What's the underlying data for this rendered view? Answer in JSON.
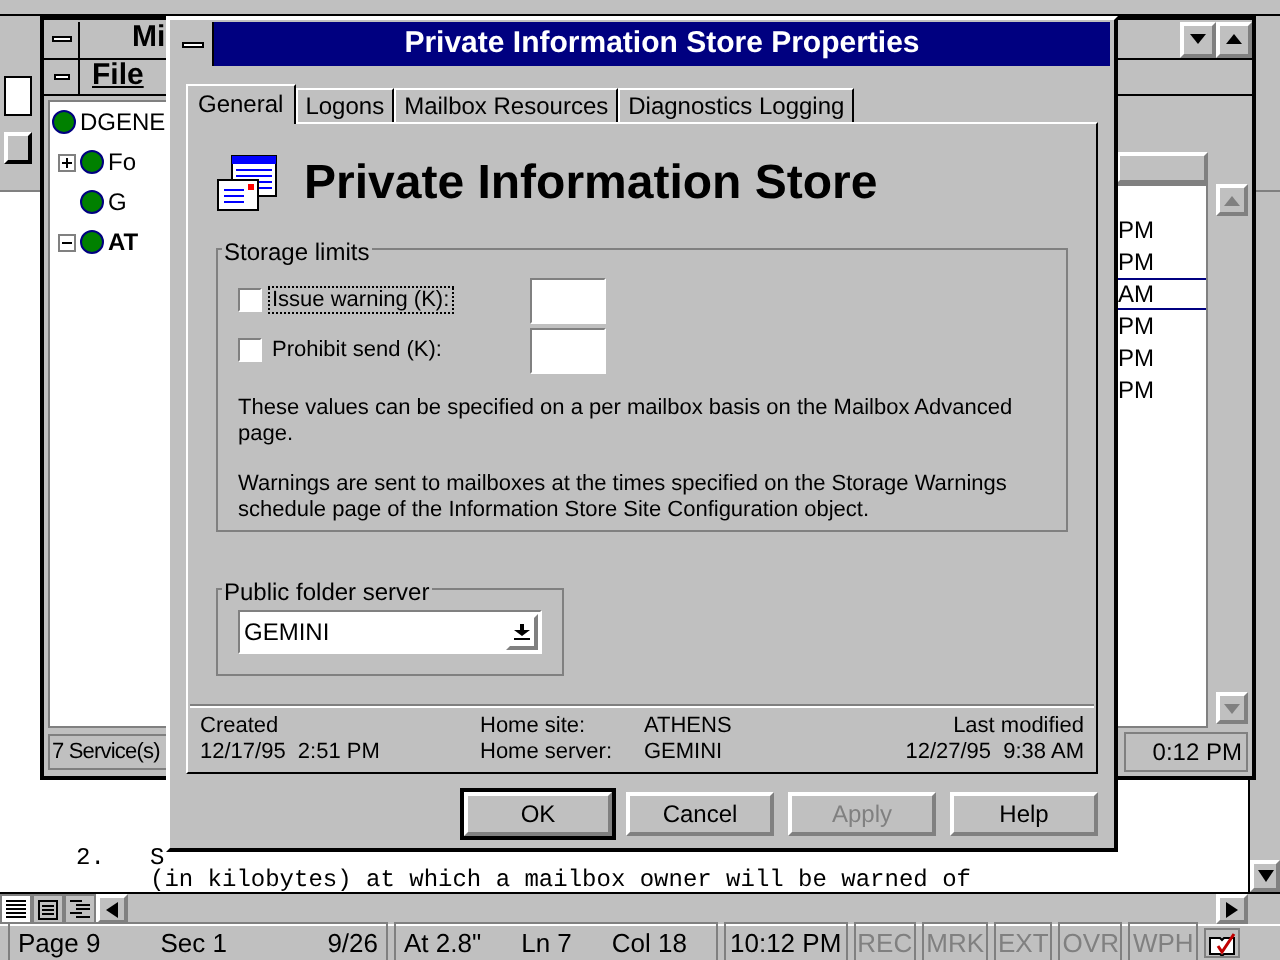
{
  "word": {
    "document_lines": [
      {
        "number": "2.",
        "text": "S"
      },
      {
        "text": "(in kilobytes) at which a mailbox owner will be warned of"
      }
    ],
    "status_bar": {
      "page": "Page 9",
      "section": "Sec 1",
      "pages": "9/26",
      "at": "At 2.8\"",
      "line": "Ln 7",
      "column": "Col 18",
      "time": "10:12 PM",
      "indicators": [
        {
          "label": "REC",
          "on": false
        },
        {
          "label": "MRK",
          "on": false
        },
        {
          "label": "EXT",
          "on": false
        },
        {
          "label": "OVR",
          "on": false
        },
        {
          "label": "WPH",
          "on": false
        }
      ]
    }
  },
  "admin_window": {
    "title": "Mi",
    "menu": [
      "File"
    ],
    "tree": [
      {
        "label": "DGENE",
        "children": [
          {
            "label": "Fo",
            "expanded": false
          },
          {
            "label": "G"
          },
          {
            "label": "AT",
            "bold": true,
            "expanded": true
          }
        ]
      }
    ],
    "list_rows": [
      {
        "column_1": "PM",
        "selected": false
      },
      {
        "column_1": "PM",
        "selected": false
      },
      {
        "column_1": "AM",
        "selected": true
      },
      {
        "column_1": "PM",
        "selected": false
      },
      {
        "column_1": "PM",
        "selected": false
      },
      {
        "column_1": "PM",
        "selected": false
      }
    ],
    "status_bar": {
      "services": "7 Service(s)",
      "time": "0:12 PM"
    }
  },
  "dialog": {
    "title": "Private Information Store Properties",
    "tabs": [
      {
        "label": "General",
        "selected": true
      },
      {
        "label": "Logons",
        "selected": false
      },
      {
        "label": "Mailbox Resources",
        "selected": false
      },
      {
        "label": "Diagnostics Logging",
        "selected": false
      }
    ],
    "heading": "Private Information Store",
    "storage_limits": {
      "title": "Storage limits",
      "limits": [
        {
          "label": "Issue warning (K):",
          "checked": false,
          "focused": true
        },
        {
          "label": "Prohibit send (K):",
          "checked": false,
          "focused": false
        }
      ],
      "notes": [
        "These values can be specified on a per mailbox basis on the Mailbox Advanced page.",
        "Warnings are sent to mailboxes at the times specified on the Storage Warnings schedule page of the Information Store Site Configuration object."
      ]
    },
    "public_folder_server": {
      "title": "Public folder server",
      "value": "GEMINI"
    },
    "created": {
      "label": "Created",
      "value": "12/17/95  2:51 PM"
    },
    "home_site": {
      "label": "Home site:",
      "value": "ATHENS"
    },
    "home_server": {
      "label": "Home server:",
      "value": "GEMINI"
    },
    "last_modified": {
      "label": "Last modified",
      "value": "12/27/95  9:38 AM"
    },
    "buttons": [
      {
        "label": "OK",
        "default": true,
        "disabled": false
      },
      {
        "label": "Cancel",
        "default": false,
        "disabled": false
      },
      {
        "label": "Apply",
        "default": false,
        "disabled": true
      },
      {
        "label": "Help",
        "default": false,
        "disabled": false
      }
    ]
  }
}
